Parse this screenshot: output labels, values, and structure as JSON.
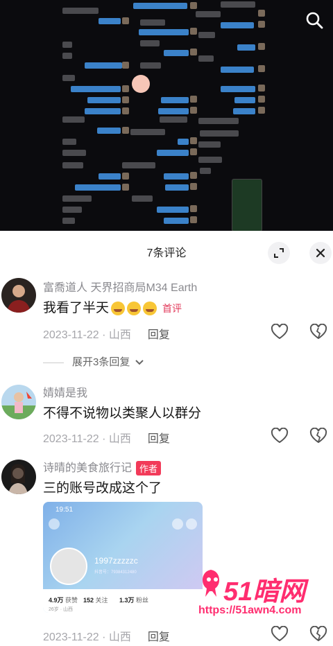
{
  "sheet": {
    "title": "7条评论"
  },
  "comments": [
    {
      "username": "富喬道人 天界招商局M34 Earth",
      "text": "我看了半天",
      "emoji_count": 3,
      "badge": "首评",
      "date": "2023-11-22",
      "location": "山西",
      "reply": "回复",
      "expand_replies": "展开3条回复"
    },
    {
      "username": "婧婧是我",
      "text": "不得不说物以类聚人以群分",
      "date": "2023-11-22",
      "location": "山西",
      "reply": "回复"
    },
    {
      "username": "诗晴的美食旅行记",
      "author_badge": "作者",
      "text": "三的账号改成这个了",
      "date": "2023-11-22",
      "location": "山西",
      "reply": "回复",
      "image": {
        "time": "19:51",
        "profile_name": "1997zzzzzc",
        "profile_id": "抖音号：79384312480",
        "likes_value": "4.9万",
        "likes_label": "获赞",
        "following_value": "152",
        "following_label": "关注",
        "followers_value": "1.3万",
        "followers_label": "粉丝",
        "extra": "26岁 · 山西"
      }
    }
  ],
  "watermark": {
    "title": "51暗网",
    "url": "https://51awn4.com"
  },
  "colors": {
    "accent": "#f23a59",
    "link_blue": "#3b82c9"
  }
}
